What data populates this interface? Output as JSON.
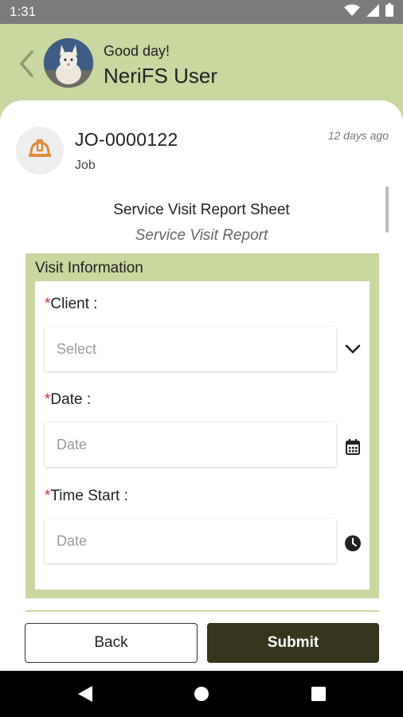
{
  "status_bar": {
    "time": "1:31"
  },
  "header": {
    "greeting": "Good day!",
    "username": "NeriFS User"
  },
  "job": {
    "number": "JO-0000122",
    "type": "Job",
    "timestamp": "12 days ago"
  },
  "report": {
    "title": "Service Visit Report Sheet",
    "subtitle": "Service Visit Report"
  },
  "section": {
    "title": "Visit Information",
    "fields": [
      {
        "required_mark": "*",
        "label": "Client :",
        "placeholder": "Select",
        "icon": "chevron-down-icon"
      },
      {
        "required_mark": "*",
        "label": "Date :",
        "placeholder": "Date",
        "icon": "calendar-icon"
      },
      {
        "required_mark": "*",
        "label": "Time Start :",
        "placeholder": "Date",
        "icon": "clock-icon"
      }
    ]
  },
  "actions": {
    "back_label": "Back",
    "submit_label": "Submit"
  },
  "colors": {
    "header_bg": "#c9d7a0",
    "submit_bg": "#35361c",
    "job_icon": "#e08a3c",
    "required": "#d32f2f"
  }
}
